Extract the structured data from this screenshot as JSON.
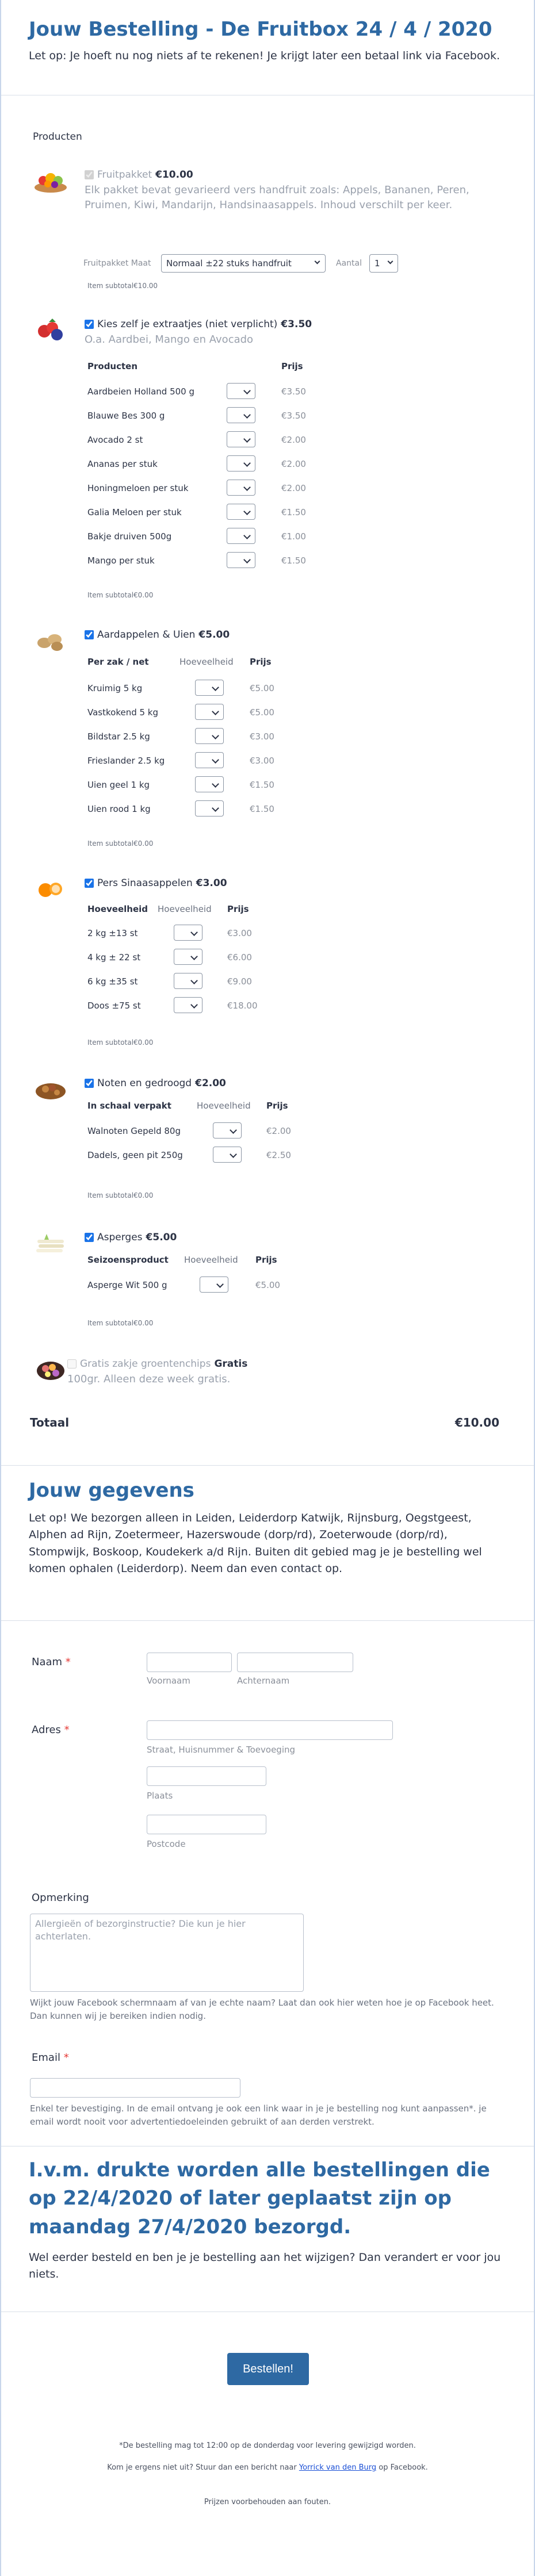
{
  "header": {
    "title": "Jouw Bestelling - De Fruitbox 24 / 4 / 2020",
    "subtitle": "Let op: Je hoeft nu nog niets af te rekenen! Je krijgt later een betaal link via Facebook."
  },
  "products_label": "Producten",
  "fruitpakket": {
    "title": "Fruitpakket",
    "price": "€10.00",
    "checked": true,
    "description": "Elk pakket bevat gevarieerd vers handfruit zoals: Appels, Bananen, Peren, Pruimen, Kiwi, Mandarijn, Handsinaasappels. Inhoud verschilt per keer.",
    "maat_label": "Fruitpakket Maat",
    "maat_value": "Normaal ±22 stuks handfruit",
    "aantal_label": "Aantal",
    "aantal_value": "1",
    "subtotal_label": "Item subtotal",
    "subtotal_value": "€10.00"
  },
  "extraatjes": {
    "title": "Kies zelf je extraatjes (niet verplicht)",
    "price": "€3.50",
    "description": "O.a. Aardbei, Mango en Avocado",
    "headers": {
      "product": "Producten",
      "price": "Prijs"
    },
    "rows": [
      {
        "name": "Aardbeien Holland 500 g",
        "price": "€3.50"
      },
      {
        "name": "Blauwe Bes 300 g",
        "price": "€3.50"
      },
      {
        "name": "Avocado 2 st",
        "price": "€2.00"
      },
      {
        "name": "Ananas per stuk",
        "price": "€2.00"
      },
      {
        "name": "Honingmeloen per stuk",
        "price": "€2.00"
      },
      {
        "name": "Galia Meloen per stuk",
        "price": "€1.50"
      },
      {
        "name": "Bakje druiven 500g",
        "price": "€1.00"
      },
      {
        "name": "Mango per stuk",
        "price": "€1.50"
      }
    ],
    "subtotal_label": "Item subtotal",
    "subtotal_value": "€0.00"
  },
  "aardappelen": {
    "title": "Aardappelen & Uien",
    "price": "€5.00",
    "headers": {
      "product": "Per zak / net",
      "qty": "Hoeveelheid",
      "price": "Prijs"
    },
    "rows": [
      {
        "name": "Kruimig 5 kg",
        "price": "€5.00"
      },
      {
        "name": "Vastkokend 5 kg",
        "price": "€5.00"
      },
      {
        "name": "Bildstar 2.5 kg",
        "price": "€3.00"
      },
      {
        "name": "Frieslander 2.5 kg",
        "price": "€3.00"
      },
      {
        "name": "Uien geel 1 kg",
        "price": "€1.50"
      },
      {
        "name": "Uien rood 1 kg",
        "price": "€1.50"
      }
    ],
    "subtotal_label": "Item subtotal",
    "subtotal_value": "€0.00"
  },
  "sinaasappels": {
    "title": "Pers Sinaasappelen",
    "price": "€3.00",
    "headers": {
      "product": "Hoeveelheid",
      "qty": "Hoeveelheid",
      "price": "Prijs"
    },
    "rows": [
      {
        "name": "2 kg ±13 st",
        "price": "€3.00"
      },
      {
        "name": "4 kg ± 22 st",
        "price": "€6.00"
      },
      {
        "name": "6 kg ±35 st",
        "price": "€9.00"
      },
      {
        "name": "Doos ±75 st",
        "price": "€18.00"
      }
    ],
    "subtotal_label": "Item subtotal",
    "subtotal_value": "€0.00"
  },
  "noten": {
    "title": "Noten en gedroogd",
    "price": "€2.00",
    "headers": {
      "product": "In schaal verpakt",
      "qty": "Hoeveelheid",
      "price": "Prijs"
    },
    "rows": [
      {
        "name": "Walnoten Gepeld 80g",
        "price": "€2.00"
      },
      {
        "name": "Dadels, geen pit 250g",
        "price": "€2.50"
      }
    ],
    "subtotal_label": "Item subtotal",
    "subtotal_value": "€0.00"
  },
  "asperges": {
    "title": "Asperges",
    "price": "€5.00",
    "headers": {
      "product": "Seizoensproduct",
      "qty": "Hoeveelheid",
      "price": "Prijs"
    },
    "rows": [
      {
        "name": "Asperge Wit 500 g",
        "price": "€5.00"
      }
    ],
    "subtotal_label": "Item subtotal",
    "subtotal_value": "€0.00"
  },
  "groentechips": {
    "title": "Gratis zakje groentenchips",
    "price": "Gratis",
    "description": "100gr. Alleen deze week gratis."
  },
  "total": {
    "label": "Totaal",
    "value": "€10.00"
  },
  "gegevens": {
    "title": "Jouw gegevens",
    "text": "Let op! We bezorgen alleen in Leiden, Leiderdorp Katwijk, Rijnsburg, Oegstgeest, Alphen ad Rijn, Zoetermeer, Hazerswoude (dorp/rd), Zoeterwoude (dorp/rd), Stompwijk, Boskoop, Koudekerk a/d Rijn. Buiten dit gebied mag je je bestelling wel komen ophalen (Leiderdorp). Neem dan even contact op."
  },
  "form": {
    "naam_label": "Naam",
    "voornaam": "Voornaam",
    "achternaam": "Achternaam",
    "adres_label": "Adres",
    "straat": "Straat, Huisnummer & Toevoeging",
    "plaats": "Plaats",
    "postcode": "Postcode",
    "opmerking_label": "Opmerking",
    "opmerking_placeholder": "Allergieën of bezorginstructie? Die kun je hier achterlaten.",
    "opmerking_help": "Wijkt jouw Facebook schermnaam af van je echte naam? Laat dan ook hier weten hoe je op Facebook heet. Dan kunnen wij je bereiken indien nodig.",
    "email_label": "Email",
    "email_help": "Enkel ter bevestiging. In de email ontvang je ook een link waar in je je bestelling nog kunt aanpassen*. je email wordt nooit voor advertentiedoeleinden gebruikt of aan derden verstrekt.",
    "required_mark": "*"
  },
  "notice": {
    "title": "I.v.m. drukte worden alle bestellingen die op 22/4/2020 of later geplaatst zijn op maandag 27/4/2020 bezorgd.",
    "text": "Wel eerder besteld en ben je je bestelling aan het wijzigen? Dan verandert er voor jou niets."
  },
  "submit_label": "Bestellen!",
  "footer": {
    "line1": "*De bestelling mag tot 12:00 op de donderdag voor levering gewijzigd worden.",
    "line2_pre": "Kom je ergens niet uit? Stuur dan een bericht naar",
    "line2_link": "Yorrick van den Burg",
    "line2_post": "op Facebook.",
    "line3": "Prijzen voorbehouden aan fouten."
  },
  "colors": {
    "accent": "#2e69a3",
    "required": "#e53935",
    "link": "#1a4fd6"
  }
}
